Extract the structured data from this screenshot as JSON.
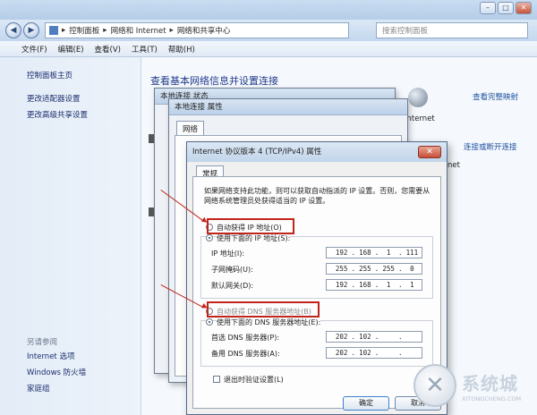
{
  "window": {
    "minimize": "–",
    "maximize": "□",
    "close": "✕"
  },
  "address": {
    "back": "◀",
    "forward": "▶",
    "path": [
      "控制面板",
      "网络和 Internet",
      "网络和共享中心"
    ],
    "separator": "▸",
    "search_placeholder": "搜索控制面板"
  },
  "menu": [
    "文件(F)",
    "编辑(E)",
    "查看(V)",
    "工具(T)",
    "帮助(H)"
  ],
  "sidebar": {
    "items": [
      "控制面板主页",
      "更改适配器设置",
      "更改高级共享设置"
    ],
    "see_also_title": "另请参阅",
    "see_also": [
      "Internet 选项",
      "Windows 防火墙",
      "家庭组"
    ]
  },
  "main": {
    "heading": "查看基本网络信息并设置连接",
    "view_full_map": "查看完整映射",
    "internet_label": "Internet",
    "connect_disconnect": "连接或断开连接",
    "net_partial": "net"
  },
  "dlg_status": {
    "title": "本地连接 状态"
  },
  "dlg_props": {
    "title": "本地连接 属性",
    "tab": "网络"
  },
  "ipv4": {
    "title": "Internet 协议版本 4 (TCP/IPv4) 属性",
    "tab": "常规",
    "intro": "如果网络支持此功能，则可以获取自动指派的 IP 设置。否则，您需要从网络系统管理员处获得适当的 IP 设置。",
    "auto_ip": "自动获得 IP 地址(O)",
    "use_ip": "使用下面的 IP 地址(S):",
    "ip_label": "IP 地址(I):",
    "ip_value": [
      "192",
      "168",
      "1",
      "111"
    ],
    "mask_label": "子网掩码(U):",
    "mask_value": [
      "255",
      "255",
      "255",
      "0"
    ],
    "gw_label": "默认网关(D):",
    "gw_value": [
      "192",
      "168",
      "1",
      "1"
    ],
    "auto_dns": "自动获得 DNS 服务器地址(B)",
    "use_dns": "使用下面的 DNS 服务器地址(E):",
    "dns1_label": "首选 DNS 服务器(P):",
    "dns1_value": [
      "202",
      "102",
      "",
      ""
    ],
    "dns2_label": "备用 DNS 服务器(A):",
    "dns2_value": [
      "202",
      "102",
      "",
      ""
    ],
    "validate": "退出时验证设置(L)",
    "ok": "确定",
    "cancel": "取消"
  },
  "watermark": {
    "text": "系统城",
    "sub": "XITONGCHENG.COM"
  },
  "colors": {
    "annotation_red": "#c0241a",
    "link_blue": "#1c4fa0"
  }
}
